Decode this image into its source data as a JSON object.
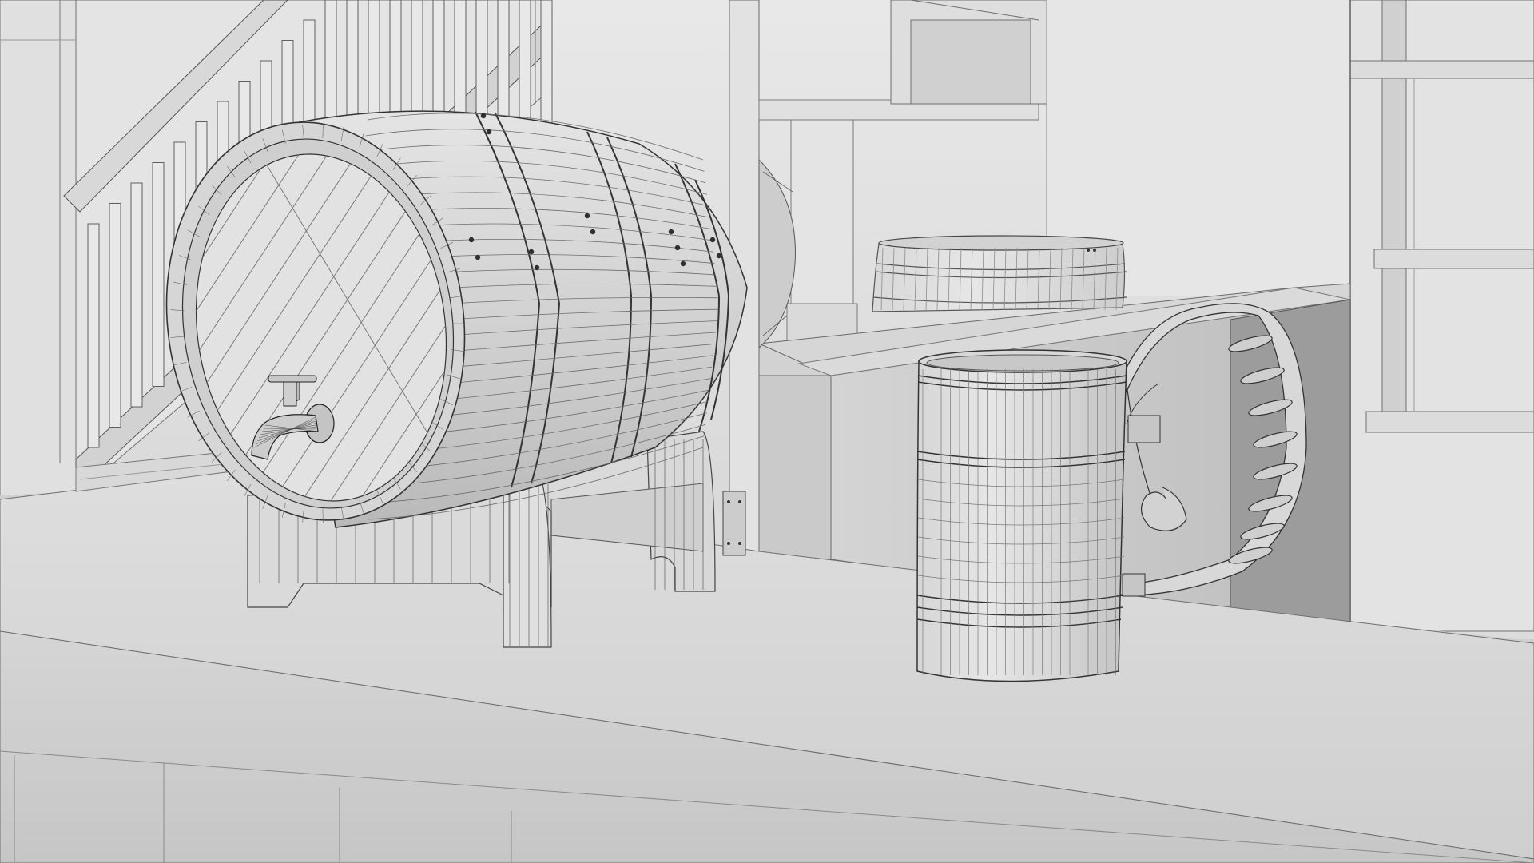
{
  "scene": {
    "subject": "wireframe-render",
    "colors": {
      "background": "#dcdcdc",
      "wall": "#e6e6e6",
      "wall_shadow": "#cfcfcf",
      "counter_top": "#d7d7d7",
      "counter_front": "#cdcdcd",
      "counter_dark": "#b9b9b9",
      "wood_light": "#e2e2e2",
      "wood_mid": "#d2d2d2",
      "wood_dark": "#bdbdbd",
      "line": "#3a3a3a",
      "line_soft": "#8a8a8a"
    },
    "objects": [
      "staircase",
      "wall-shelves",
      "barrel-on-stand",
      "barrel-tap",
      "background-barrel",
      "back-counter",
      "tankard-mug",
      "front-counter"
    ]
  }
}
